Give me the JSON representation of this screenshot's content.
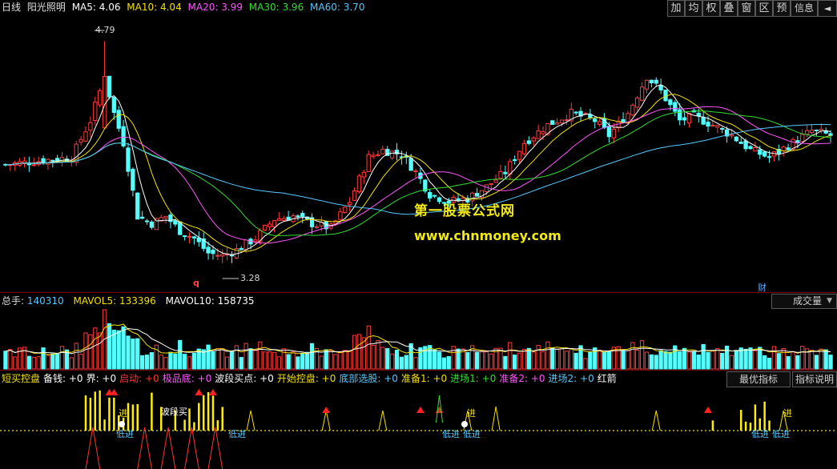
{
  "main": {
    "period": "日线",
    "name": "阳光照明",
    "ma": [
      {
        "label": "MA5: 4.06",
        "color": "#ffffff"
      },
      {
        "label": "MA10: 4.04",
        "color": "#f5e000"
      },
      {
        "label": "MA20: 3.99",
        "color": "#ff55ff"
      },
      {
        "label": "MA30: 3.96",
        "color": "#33dd33"
      },
      {
        "label": "MA60: 3.70",
        "color": "#55c8ff"
      }
    ],
    "high_label": "4.79",
    "low_label": "3.28",
    "mark_q": "q",
    "mark_cai": "财",
    "price_range": [
      3.1,
      4.95
    ],
    "toolbar": [
      "加",
      "均",
      "权",
      "叠",
      "窗",
      "区",
      "预",
      "信息",
      "◄"
    ]
  },
  "watermark": {
    "title": "第一股票公式网",
    "url": "www.chnmoney.com"
  },
  "volume": {
    "items": [
      {
        "label": "总手:",
        "value": "140310",
        "color": "#55c8ff"
      },
      {
        "label": "MAVOL5:",
        "value": "133396",
        "color": "#f5e000"
      },
      {
        "label": "MAVOL10:",
        "value": "158735",
        "color": "#ffffff"
      }
    ],
    "selector": "成交量"
  },
  "indicator": {
    "items": [
      {
        "label": "短买控盘",
        "color": "#f5e000"
      },
      {
        "label": "备钱: +0",
        "color": "#ffffff"
      },
      {
        "label": "界: +0",
        "color": "#ffffff"
      },
      {
        "label": "启动: +0",
        "color": "#ff3333"
      },
      {
        "label": "极品底: +0",
        "color": "#ff55ff"
      },
      {
        "label": "波段买点: +0",
        "color": "#ffffff"
      },
      {
        "label": "开始控盘: +0",
        "color": "#f5e000"
      },
      {
        "label": "底部选股: +0",
        "color": "#55c8ff"
      },
      {
        "label": "准备1: +0",
        "color": "#f5e000"
      },
      {
        "label": "进场1: +0",
        "color": "#33dd33"
      },
      {
        "label": "准备2: +0",
        "color": "#ff55ff"
      },
      {
        "label": "进场2: +0",
        "color": "#55c8ff"
      },
      {
        "label": "红箭",
        "color": "#ffffff"
      }
    ],
    "buttons": [
      "最优指标",
      "指标说明"
    ],
    "signals": {
      "jin": "进",
      "dijin": "低进",
      "boduanmai": "波段买"
    }
  },
  "colors": {
    "up": "#ff3a3a",
    "down": "#54ffff",
    "grid": "#7a0000"
  }
}
